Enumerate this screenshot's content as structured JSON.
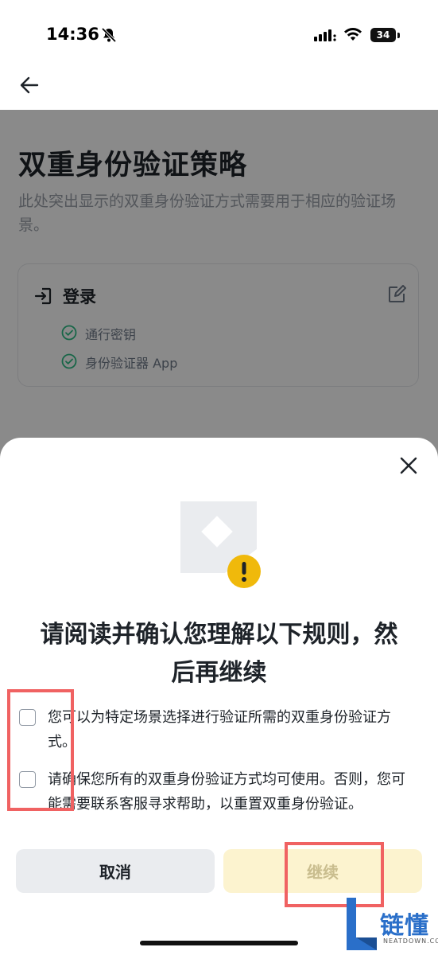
{
  "status_bar": {
    "time": "14:36",
    "battery": "34"
  },
  "page": {
    "title": "双重身份验证策略",
    "description": "此处突出显示的双重身份验证方式需要用于相应的验证场景。",
    "card": {
      "title": "登录",
      "methods": [
        "通行密钥",
        "身份验证器 App"
      ]
    }
  },
  "sheet": {
    "headline_line1": "请阅读并确认您理解以下规则，然",
    "headline_line2": "后再继续",
    "rules": [
      "您可以为特定场景选择进行验证所需的双重身份验证方式。",
      "请确保您所有的双重身份验证方式均可使用。否则，您可能需要联系客服寻求帮助，以重置双重身份验证。"
    ],
    "cancel_label": "取消",
    "continue_label": "继续"
  },
  "colors": {
    "accent": "#f0b90b",
    "continue_disabled_bg": "#fcf3cf",
    "annotation": "#f06262",
    "check_green": "#2ebd85"
  },
  "watermark": {
    "text": "链懂",
    "sub": "NEATDOWN.COM"
  }
}
